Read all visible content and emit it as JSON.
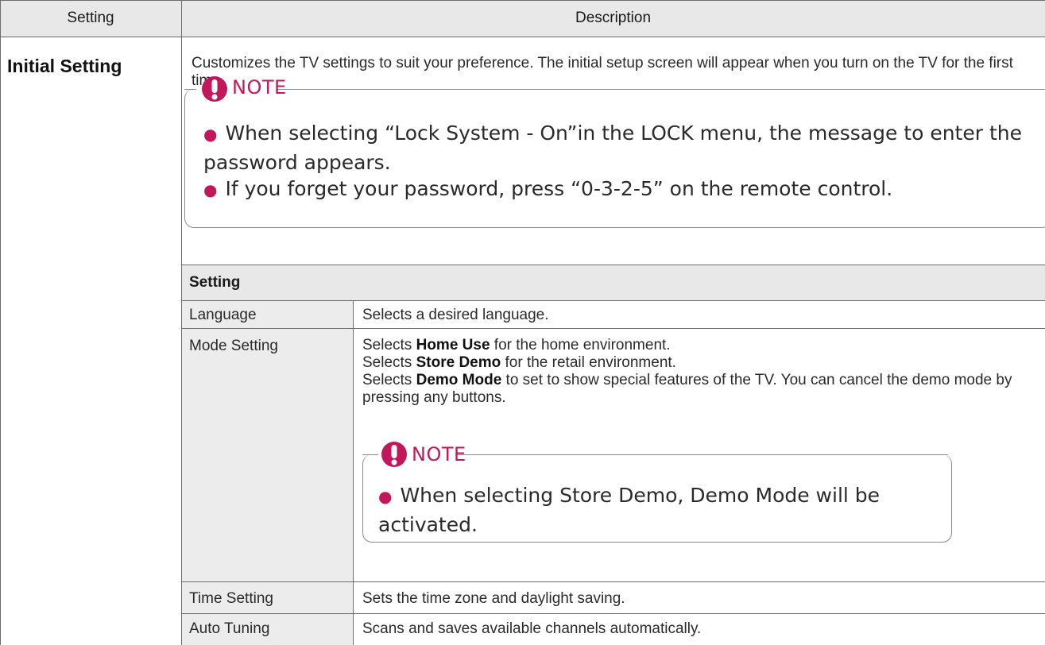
{
  "table": {
    "header": {
      "col_setting": "Setting",
      "col_description": "Description"
    },
    "row": {
      "setting": "Initial Setting",
      "description": "Customizes the TV settings to suit your preference. The initial setup screen will appear when you turn on the TV for the first time.",
      "note": {
        "title": "NOTE",
        "bullets": [
          "When selecting “Lock System - On”in the LOCK menu, the message to enter the password appears.",
          "If you forget your password, press “0-3-2-5” on the remote control."
        ]
      }
    },
    "subtable": {
      "header": "Setting",
      "rows": [
        {
          "name": "Language",
          "text": "Selects a desired language."
        },
        {
          "name": "Mode Setting",
          "lines": [
            {
              "prefix": "Selects ",
              "bold": "Home Use",
              "suffix": " for the home environment."
            },
            {
              "prefix": "Selects ",
              "bold": "Store Demo",
              "suffix": " for the retail environment."
            },
            {
              "prefix": "Selects ",
              "bold": "Demo Mode",
              "suffix": " to set to show special features of the TV. You can cancel the demo mode by pressing any buttons."
            }
          ],
          "note": {
            "title": "NOTE",
            "bullets": [
              "When selecting Store Demo, Demo Mode will be activated."
            ]
          }
        },
        {
          "name": "Time Setting",
          "text": "Sets the time zone and daylight saving."
        },
        {
          "name": "Auto Tuning",
          "text": "Scans and saves available channels automatically."
        }
      ]
    }
  },
  "colors": {
    "accent": "#c2185b",
    "header_bg": "#e8e8e8",
    "label_bg": "#ececec",
    "border": "#6d6d6d"
  }
}
